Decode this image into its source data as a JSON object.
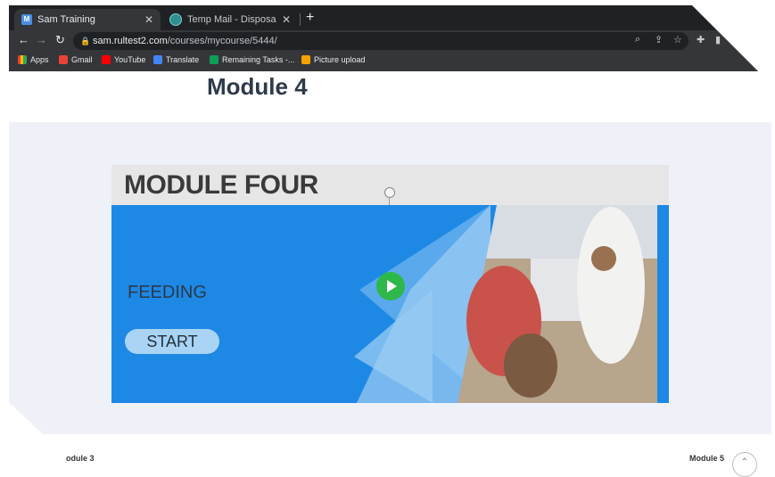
{
  "browser": {
    "tabs": [
      {
        "title": "Sam Training",
        "active": true,
        "favicon": "sam-favicon-icon"
      },
      {
        "title": "Temp Mail - Disposable Tempo",
        "active": false,
        "favicon": "tempmail-favicon-icon"
      }
    ],
    "address": {
      "host": "sam.rultest2.com",
      "path": "/courses/mycourse/5444/"
    },
    "bookmarks": [
      {
        "label": "Apps",
        "color": "#ea4335"
      },
      {
        "label": "Gmail",
        "color": "#ea4335"
      },
      {
        "label": "YouTube",
        "color": "#ff0000"
      },
      {
        "label": "Translate",
        "color": "#4285f4"
      },
      {
        "label": "Remaining Tasks -...",
        "color": "#0f9d58"
      },
      {
        "label": "Picture upload",
        "color": "#f4a300"
      }
    ]
  },
  "page": {
    "title": "Module 4",
    "slide": {
      "header": "MODULE FOUR",
      "topic": "FEEDING",
      "start_label": "START"
    },
    "nav": {
      "prev": "odule 3",
      "next": "Module 5"
    }
  },
  "colors": {
    "slide_blue": "#1e88e5",
    "play_green": "#2eb84a",
    "panel_bg": "#eef1f8"
  }
}
